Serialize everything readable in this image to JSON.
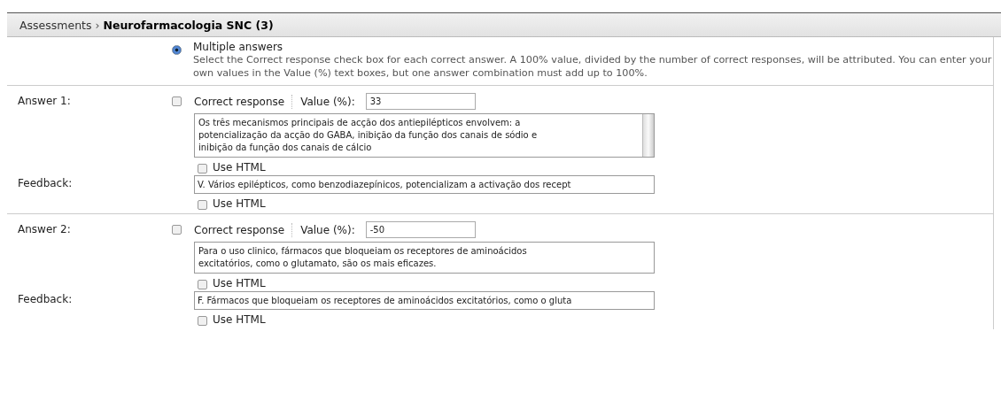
{
  "breadcrumb": {
    "parent": "Assessments",
    "separator": "›",
    "current": "Neurofarmacologia SNC (3)"
  },
  "option": {
    "label": "Multiple answers",
    "selected": true,
    "description": "Select the Correct response check box for each correct answer. A 100% value, divided by the number of correct responses, will be attributed. You can enter your own values in the Value (%) text boxes, but one answer combination must add up to 100%."
  },
  "answers": [
    {
      "label": "Answer 1:",
      "correct": false,
      "correct_label": "Correct response",
      "value_label": "Value (%):",
      "value": "33",
      "lines": [
        "Os três mecanismos principais de acção dos antiepilépticos envolvem: a",
        "potencialização da acção do GABA, inibição da função dos canais de sódio e",
        "inibição da função dos canais de cálcio"
      ],
      "scrollbar": true,
      "use_html": false,
      "use_html_label": "Use HTML",
      "feedback_label": "Feedback:",
      "feedback": "V. Vários epilépticos, como benzodiazepínicos, potencializam a activação dos recept",
      "feedback_use_html": false,
      "feedback_use_html_label": "Use HTML"
    },
    {
      "label": "Answer 2:",
      "correct": false,
      "correct_label": "Correct response",
      "value_label": "Value (%):",
      "value": "-50",
      "lines": [
        "Para o uso clinico, fármacos que bloqueiam os receptores de aminoácidos",
        "excitatórios, como o glutamato, são os mais eficazes."
      ],
      "scrollbar": false,
      "use_html": false,
      "use_html_label": "Use HTML",
      "feedback_label": "Feedback:",
      "feedback": "F. Fármacos que bloqueiam os receptores de aminoácidos excitatórios, como o gluta",
      "feedback_use_html": false,
      "feedback_use_html_label": "Use HTML"
    }
  ]
}
